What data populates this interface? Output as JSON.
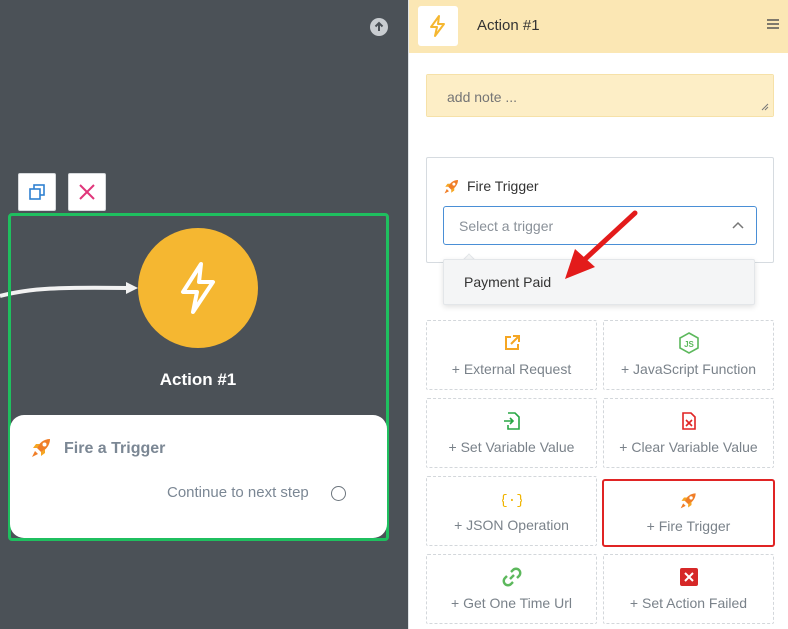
{
  "canvas": {
    "node_title": "Action #1",
    "card_title": "Fire a Trigger",
    "card_step": "Continue to next step"
  },
  "panel": {
    "header_title": "Action #1",
    "note_placeholder": "add note ...",
    "trigger_label": "Fire Trigger",
    "select_placeholder": "Select a trigger",
    "dropdown_option": "Payment Paid"
  },
  "tiles": [
    {
      "label": "+ External Request",
      "icon": "external-link-icon",
      "color": "#f5a623"
    },
    {
      "label": "+ JavaScript Function",
      "icon": "js-icon",
      "color": "#5cb85c"
    },
    {
      "label": "+ Set Variable Value",
      "icon": "file-import-icon",
      "color": "#28a745"
    },
    {
      "label": "+ Clear Variable Value",
      "icon": "file-clear-icon",
      "color": "#e02424"
    },
    {
      "label": "+ JSON Operation",
      "icon": "json-braces-icon",
      "color": "#f0b400"
    },
    {
      "label": "+ Fire Trigger",
      "icon": "rocket-icon",
      "color": "#f07e28"
    },
    {
      "label": "+ Get One Time Url",
      "icon": "link-icon",
      "color": "#5cb85c"
    },
    {
      "label": "+ Set Action Failed",
      "icon": "x-box-icon",
      "color": "#d62828"
    }
  ],
  "colors": {
    "node_yellow": "#f5b731",
    "selection_green": "#1fbf5f",
    "highlight_red": "#e02424"
  }
}
